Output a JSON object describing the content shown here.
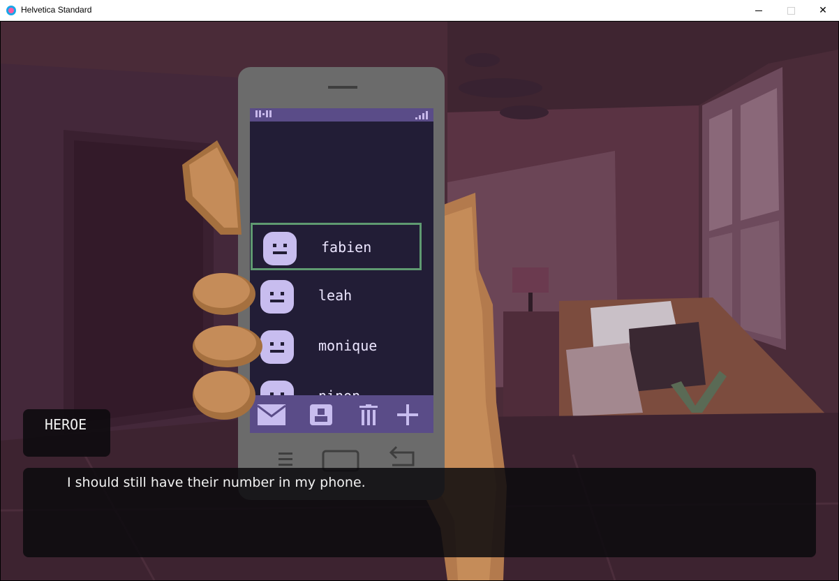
{
  "window": {
    "title": "Helvetica Standard",
    "minimize_label": "",
    "maximize_label": "",
    "close_label": "✕"
  },
  "phone": {
    "contacts": [
      {
        "name": "fabien",
        "selected": true
      },
      {
        "name": "leah",
        "selected": false
      },
      {
        "name": "monique",
        "selected": false
      },
      {
        "name": "ninon",
        "selected": false
      }
    ],
    "toolbar": [
      "mail-icon",
      "contact-card-icon",
      "trash-icon",
      "plus-icon"
    ],
    "nav": [
      "menu-icon",
      "home-icon",
      "back-icon"
    ]
  },
  "dialogue": {
    "speaker": "HEROE",
    "text": "I should still have their number in my phone."
  },
  "colors": {
    "screen_bg": "#221d36",
    "toolbar_bg": "#5a4c88",
    "avatar": "#c8bdef",
    "selection": "#5f9a71"
  }
}
